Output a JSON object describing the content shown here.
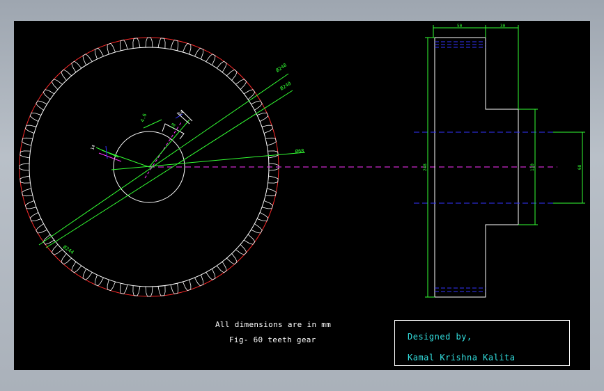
{
  "notes": {
    "dimensions_note": "All dimensions are in mm",
    "figure_caption": "Fig- 60 teeth gear"
  },
  "title_block": {
    "designed_by_label": "Designed by,",
    "designer_name": "Kamal Krishna Kalita"
  },
  "front_view": {
    "teeth_count": 60,
    "dimensions": {
      "tip_diameter": "Ø248",
      "pitch_diameter": "Ø240",
      "root_diameter": "Ø244",
      "bore_diameter": "Ø68",
      "keyway_width": "18",
      "keyway_depth": "4.6",
      "key_label_left": "14",
      "key_label_right": "14"
    }
  },
  "side_view": {
    "dimensions": {
      "face_width": "50",
      "hub_width": "30",
      "outer_height": "248",
      "hub_height": "110",
      "bore_height": "68"
    }
  },
  "colors": {
    "background": "#000000",
    "geometry": "#ffffff",
    "dimension": "#33ff33",
    "addendum_circle": "#ff2b2b",
    "centerline": "#ff33ff",
    "hidden_line": "#3333ff",
    "title_text": "#33e0e0"
  }
}
